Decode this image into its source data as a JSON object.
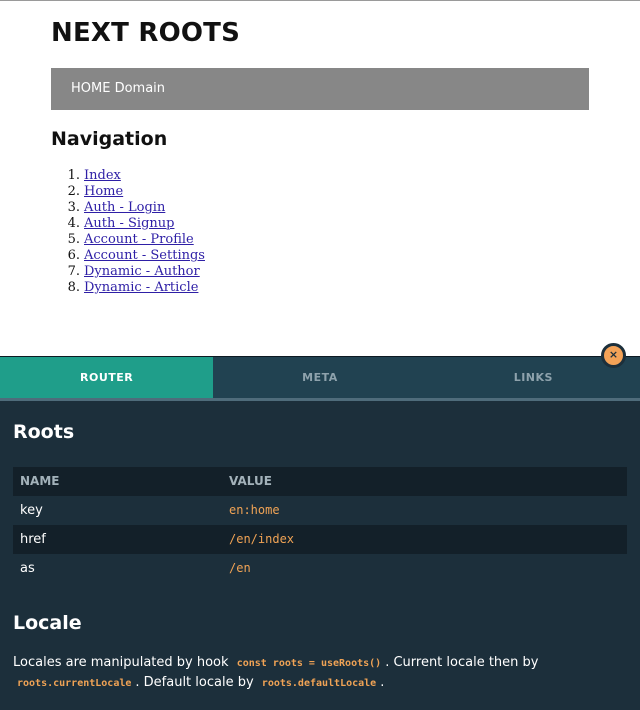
{
  "header": {
    "title": "NEXT ROOTS",
    "domain_label": "HOME Domain"
  },
  "navigation": {
    "title": "Navigation",
    "items": [
      {
        "num": "1.",
        "label": "Index"
      },
      {
        "num": "2.",
        "label": "Home"
      },
      {
        "num": "3.",
        "label": "Auth - Login"
      },
      {
        "num": "4.",
        "label": "Auth - Signup"
      },
      {
        "num": "5.",
        "label": "Account - Profile"
      },
      {
        "num": "6.",
        "label": "Account - Settings"
      },
      {
        "num": "7.",
        "label": "Dynamic - Author"
      },
      {
        "num": "8.",
        "label": "Dynamic - Article"
      }
    ]
  },
  "devtools": {
    "close_label": "×",
    "tabs": [
      {
        "label": "ROUTER",
        "active": true
      },
      {
        "label": "META",
        "active": false
      },
      {
        "label": "LINKS",
        "active": false
      }
    ],
    "roots": {
      "title": "Roots",
      "columns": [
        "NAME",
        "VALUE"
      ],
      "rows": [
        {
          "name": "key",
          "value": "en:home"
        },
        {
          "name": "href",
          "value": "/en/index"
        },
        {
          "name": "as",
          "value": "/en"
        }
      ]
    },
    "locale": {
      "title": "Locale",
      "text1": "Locales are manipulated by hook",
      "code1": "const roots = useRoots()",
      "text2": ". Current locale then by",
      "code2": "roots.currentLocale",
      "text3": ". Default locale by",
      "code3": "roots.defaultLocale",
      "text4": "."
    }
  },
  "colors": {
    "accent": "#1f9e8a",
    "panel_bg": "#1c2f3b",
    "code": "#f0a355",
    "close_button": "#f3a257"
  }
}
